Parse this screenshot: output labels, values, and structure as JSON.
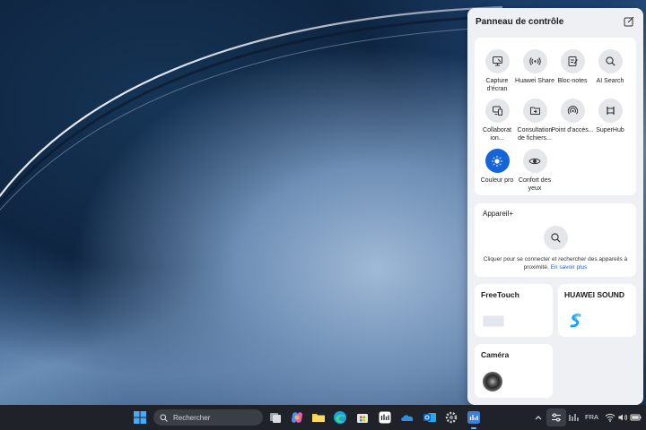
{
  "control_panel": {
    "title": "Panneau de contrôle",
    "tiles": [
      {
        "label": "Capture d'écran",
        "icon": "screen-capture-icon",
        "active": false
      },
      {
        "label": "Huawei Share",
        "icon": "huawei-share-icon",
        "active": false
      },
      {
        "label": "Bloc-notes",
        "icon": "notepad-icon",
        "active": false
      },
      {
        "label": "AI Search",
        "icon": "search-icon",
        "active": false
      },
      {
        "label": "Collaborat ion...",
        "icon": "collaboration-icon",
        "active": false
      },
      {
        "label": "Consultation de fichiers...",
        "icon": "file-browse-icon",
        "active": false
      },
      {
        "label": "Point d'accès...",
        "icon": "hotspot-icon",
        "active": false
      },
      {
        "label": "SuperHub",
        "icon": "superhub-icon",
        "active": false
      },
      {
        "label": "Couleur pro",
        "icon": "color-pro-icon",
        "active": true
      },
      {
        "label": "Confort des yeux",
        "icon": "eye-comfort-icon",
        "active": false
      }
    ],
    "appareil": {
      "title": "Appareil+",
      "text": "Cliquer pour se connecter et rechercher des appareils à proximité.",
      "link": "En savoir plus"
    },
    "freetouch": {
      "title": "FreeTouch"
    },
    "huawei_sound": {
      "title": "HUAWEI SOUND"
    },
    "camera": {
      "title": "Caméra"
    }
  },
  "taskbar": {
    "search_placeholder": "Rechercher",
    "language": "FRA"
  },
  "colors": {
    "accent": "#1565d8",
    "panel_bg": "#eef0f3",
    "taskbar_bg": "#1f2329"
  }
}
